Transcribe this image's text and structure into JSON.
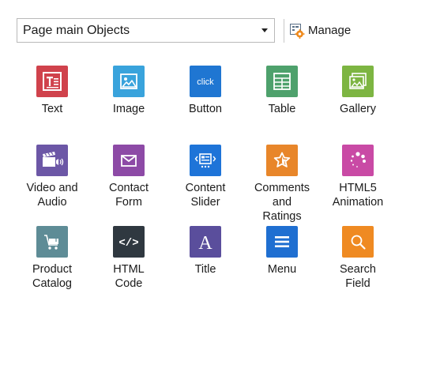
{
  "header": {
    "dropdown_value": "Page main Objects",
    "manage_label": "Manage"
  },
  "objects": [
    {
      "id": "text",
      "label": "Text",
      "icon": "text-icon",
      "color": "#d0424c"
    },
    {
      "id": "image",
      "label": "Image",
      "icon": "image-icon",
      "color": "#39a3dc"
    },
    {
      "id": "button",
      "label": "Button",
      "icon": "button-icon",
      "color": "#1f76d2",
      "icon_text": "click"
    },
    {
      "id": "table",
      "label": "Table",
      "icon": "table-icon",
      "color": "#4ea16c"
    },
    {
      "id": "gallery",
      "label": "Gallery",
      "icon": "gallery-icon",
      "color": "#7db542"
    },
    {
      "id": "video-audio",
      "label": "Video and\nAudio",
      "icon": "video-audio-icon",
      "color": "#6c57a6"
    },
    {
      "id": "contact-form",
      "label": "Contact\nForm",
      "icon": "mail-icon",
      "color": "#8d4aa6"
    },
    {
      "id": "content-slider",
      "label": "Content\nSlider",
      "icon": "slider-icon",
      "color": "#1e74d8"
    },
    {
      "id": "comments-ratings",
      "label": "Comments\nand\nRatings",
      "icon": "rating-icon",
      "color": "#e8862a"
    },
    {
      "id": "html5-animation",
      "label": "HTML5\nAnimation",
      "icon": "animation-icon",
      "color": "#c94aa5"
    },
    {
      "id": "product-catalog",
      "label": "Product\nCatalog",
      "icon": "cart-icon",
      "color": "#5e8c96"
    },
    {
      "id": "html-code",
      "label": "HTML\nCode",
      "icon": "code-icon",
      "color": "#2f3840",
      "icon_text": "</>"
    },
    {
      "id": "title",
      "label": "Title",
      "icon": "title-icon",
      "color": "#5a4e9c",
      "icon_text": "A"
    },
    {
      "id": "menu",
      "label": "Menu",
      "icon": "menu-icon",
      "color": "#1f6fd1"
    },
    {
      "id": "search-field",
      "label": "Search\nField",
      "icon": "search-icon",
      "color": "#ef8a22"
    }
  ]
}
